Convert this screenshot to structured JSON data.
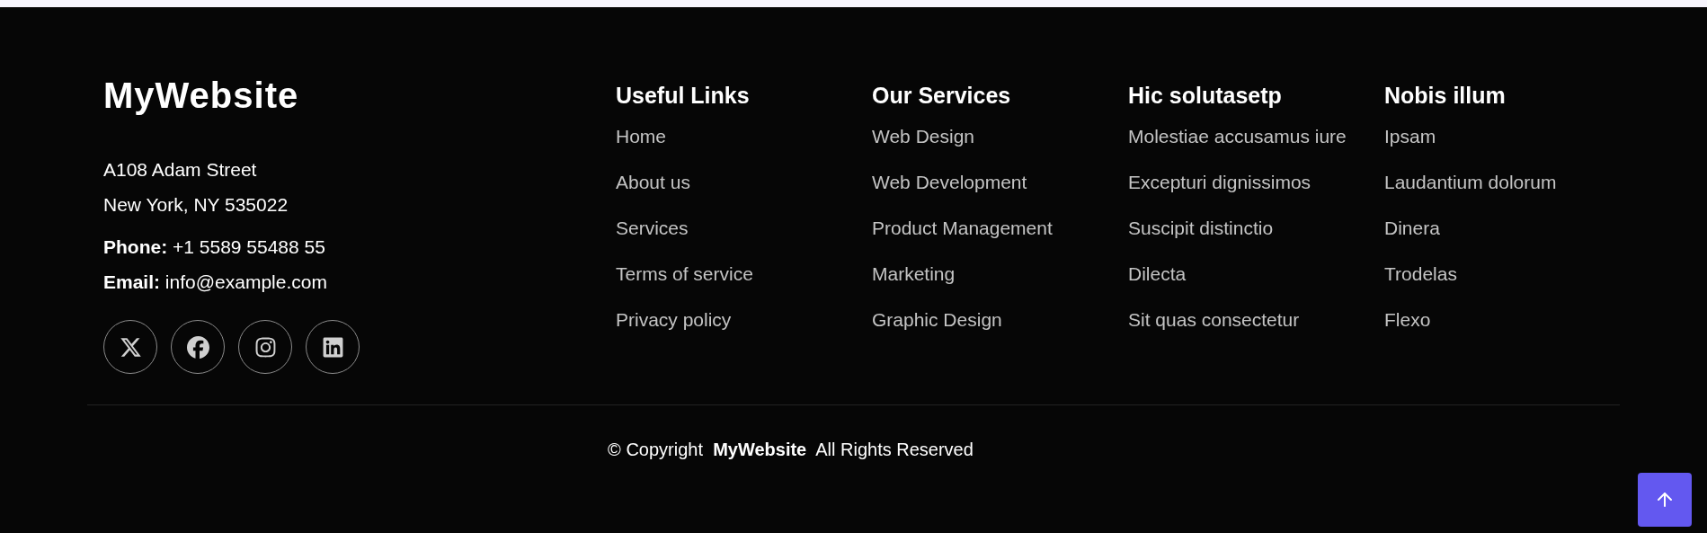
{
  "brand": "MyWebsite",
  "address": [
    "A108 Adam Street",
    "New York, NY 535022"
  ],
  "contacts": [
    "**Phone:** +1 5589 55488 55",
    "**Email:** info@example.com"
  ],
  "social": [
    {
      "kind": "x"
    },
    {
      "kind": "facebook"
    },
    {
      "kind": "instagram"
    },
    {
      "kind": "linkedin"
    }
  ],
  "columns": [
    {
      "title": "Useful Links",
      "links": [
        "Home",
        "About us",
        "Services",
        "Terms of service",
        "Privacy policy"
      ]
    },
    {
      "title": "Our Services",
      "links": [
        "Web Design",
        "Web Development",
        "Product Management",
        "Marketing",
        "Graphic Design"
      ]
    },
    {
      "title": "Hic solutasetp",
      "links": [
        "Molestiae accusamus iure",
        "Excepturi dignissimos",
        "Suscipit distinctio",
        "Dilecta",
        "Sit quas consectetur"
      ]
    },
    {
      "title": "Nobis illum",
      "links": [
        "Ipsam",
        "Laudantium dolorum",
        "Dinera",
        "Trodelas",
        "Flexo"
      ]
    }
  ],
  "copyright": "© Copyright  **MyWebsite**  All Rights Reserved"
}
